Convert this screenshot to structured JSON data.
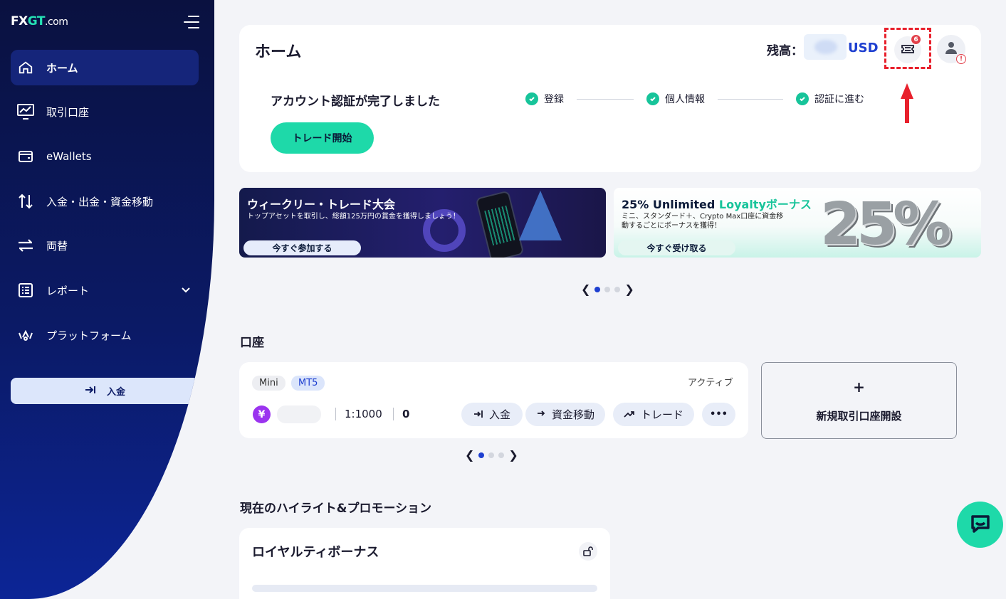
{
  "sidebar": {
    "logo": {
      "part1": "FX",
      "part2": "GT",
      "part3": ".com"
    },
    "items": [
      {
        "label": "ホーム",
        "icon": "home-icon",
        "active": true
      },
      {
        "label": "取引口座",
        "icon": "chart-monitor-icon"
      },
      {
        "label": "eWallets",
        "icon": "wallet-icon"
      },
      {
        "label": "入金・出金・資金移動",
        "icon": "transfer-arrows-icon"
      },
      {
        "label": "両替",
        "icon": "exchange-icon"
      },
      {
        "label": "レポート",
        "icon": "report-list-icon"
      },
      {
        "label": "プラットフォーム",
        "icon": "platform-icon"
      }
    ],
    "deposit_label": "入金"
  },
  "header": {
    "title": "ホーム",
    "balance_label": "残高：",
    "currency": "USD",
    "notification_count": "6",
    "avatar_warning": "!"
  },
  "verification": {
    "title": "アカウント認証が完了しました",
    "steps": [
      "登録",
      "個人情報",
      "認証に進む"
    ],
    "cta": "トレード開始"
  },
  "banners": [
    {
      "title": "ウィークリー・トレード大会",
      "subtitle": "トップアセットを取引し、総額125万円の賞金を獲得しましょう！",
      "cta": "今すぐ参加する"
    },
    {
      "title_prefix": "25% Unlimited ",
      "title_highlight": "Loyaltyボーナス",
      "subtitle_line1": "ミニ、スタンダード＋、Crypto Max口座に資金移",
      "subtitle_line2": "動するごとにボーナスを獲得！",
      "cta": "今すぐ受け取る",
      "graphic_text": "25%"
    }
  ],
  "accounts": {
    "section_title": "口座",
    "account": {
      "tags": [
        "Mini",
        "MT5"
      ],
      "status": "アクティブ",
      "currency_symbol": "¥",
      "leverage": "1:1000",
      "balance": "0",
      "actions": [
        "入金",
        "資金移動",
        "トレード"
      ],
      "more": "•••"
    },
    "new_account": {
      "plus": "+",
      "label": "新規取引口座開設"
    }
  },
  "promotions": {
    "section_title": "現在のハイライト&プロモーション",
    "card_title": "ロイヤルティボーナス"
  },
  "colors": {
    "accent": "#1ed9a9",
    "brand_blue": "#1e3fd0",
    "sidebar": "#0b1a66",
    "highlight_red": "#e8202c"
  }
}
